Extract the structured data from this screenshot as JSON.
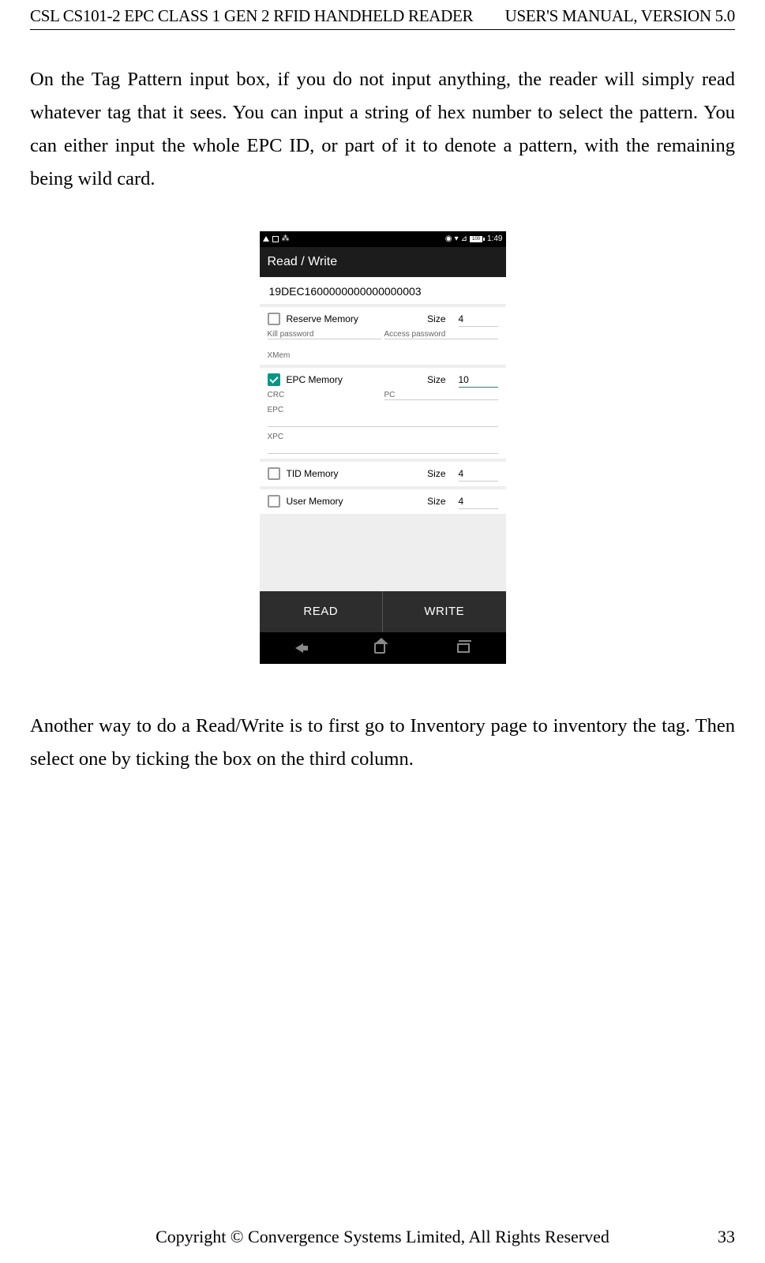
{
  "header": {
    "left": "CSL CS101-2 EPC CLASS 1 GEN 2 RFID HANDHELD READER",
    "right": "USER'S  MANUAL,  VERSION  5.0"
  },
  "para1": "On the Tag Pattern input box, if you do not input anything, the reader will simply read whatever tag that it sees.   You can input a string of hex number to select the pattern.   You can either input the whole EPC ID, or part of it to denote a pattern, with the remaining being wild card.",
  "para2": "Another way to do a Read/Write is to first go to Inventory page to inventory the tag.   Then select one by ticking the box on the third column.",
  "phone": {
    "status": {
      "time": "1:49",
      "battery": "100"
    },
    "title": "Read / Write",
    "epc": "19DEC1600000000000000003",
    "reserve": {
      "label": "Reserve Memory",
      "size_label": "Size",
      "size": "4",
      "kill": "Kill password",
      "access": "Access password"
    },
    "xmem": "XMem",
    "epcmem": {
      "label": "EPC Memory",
      "size_label": "Size",
      "size": "10",
      "crc": "CRC",
      "pc": "PC",
      "epc": "EPC",
      "xpc": "XPC"
    },
    "tid": {
      "label": "TID Memory",
      "size_label": "Size",
      "size": "4"
    },
    "user": {
      "label": "User Memory",
      "size_label": "Size",
      "size": "4"
    },
    "actions": {
      "read": "READ",
      "write": "WRITE"
    }
  },
  "footer": {
    "copyright": "Copyright © Convergence Systems Limited, All Rights Reserved",
    "page": "33"
  }
}
